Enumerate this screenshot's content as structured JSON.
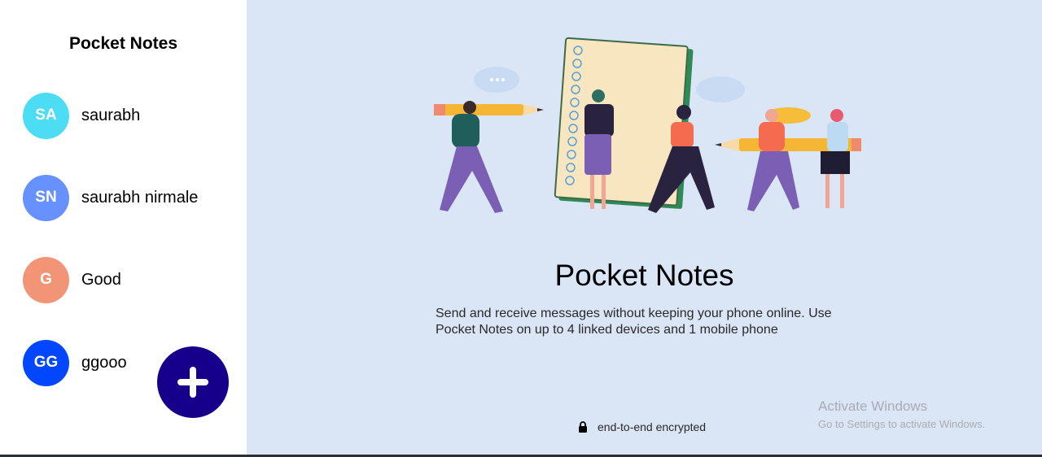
{
  "sidebar": {
    "title": "Pocket Notes",
    "groups": [
      {
        "initials": "SA",
        "name": "saurabh",
        "color": "#4cdcf3"
      },
      {
        "initials": "SN",
        "name": "saurabh nirmale",
        "color": "#6691ff"
      },
      {
        "initials": "G",
        "name": "Good",
        "color": "#f19576"
      },
      {
        "initials": "GG",
        "name": "ggooo",
        "color": "#0047ff"
      }
    ],
    "add_button": {
      "icon": "plus-icon",
      "color": "#16008b"
    }
  },
  "main": {
    "title": "Pocket Notes",
    "description": "Send and receive messages without keeping your phone online. Use Pocket Notes on up to 4 linked devices and 1 mobile phone",
    "encrypted_label": "end-to-end encrypted",
    "encrypted_icon": "lock-icon",
    "background": "#dae5f5"
  },
  "watermark": {
    "title": "Activate Windows",
    "subtitle": "Go to Settings to activate Windows."
  }
}
